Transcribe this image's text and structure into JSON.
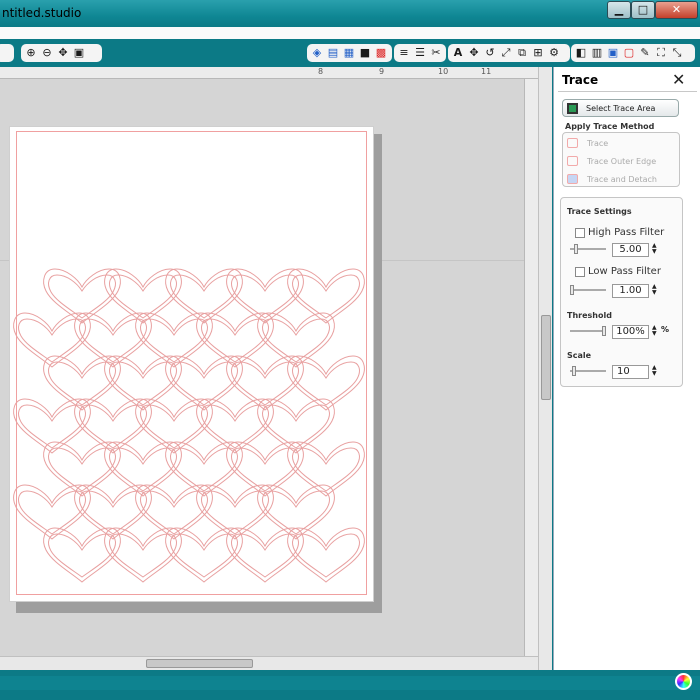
{
  "window": {
    "title": "ntitled.studio",
    "minimize_glyph": "▁",
    "maximize_glyph": "□",
    "close_glyph": "✕"
  },
  "toolbar": {
    "zoom_group": [
      "zoom-in-icon",
      "zoom-out-icon",
      "pan-icon",
      "fit-page-icon"
    ],
    "right_group": [
      "grid-icon",
      "page-setup-icon",
      "cut-settings-icon",
      "fill-icon",
      "line-style-icon",
      "registration-icon",
      "text-icon",
      "shape-icon",
      "replicate-icon",
      "transform-icon",
      "align-icon",
      "weld-icon",
      "trace-icon",
      "layers-icon",
      "library-icon",
      "pen-icon",
      "expand-icon"
    ]
  },
  "ruler": {
    "h_labels": [
      "8",
      "9",
      "10",
      "11"
    ]
  },
  "panel": {
    "title": "Trace",
    "close_glyph": "✕",
    "select_trace_area": "Select Trace Area",
    "apply_method_label": "Apply Trace Method",
    "methods": [
      "Trace",
      "Trace Outer Edge",
      "Trace and Detach"
    ],
    "settings_label": "Trace Settings",
    "high_pass": {
      "label": "High Pass Filter",
      "value": "5.00"
    },
    "low_pass": {
      "label": "Low Pass Filter",
      "value": "1.00"
    },
    "threshold": {
      "label": "Threshold",
      "value": "100%",
      "unit": "%"
    },
    "scale": {
      "label": "Scale",
      "value": "10"
    }
  },
  "colors": {
    "accent": "#0c7a86",
    "heart_outline": "#e8a0a0",
    "workspace": "#d5d5d5"
  }
}
